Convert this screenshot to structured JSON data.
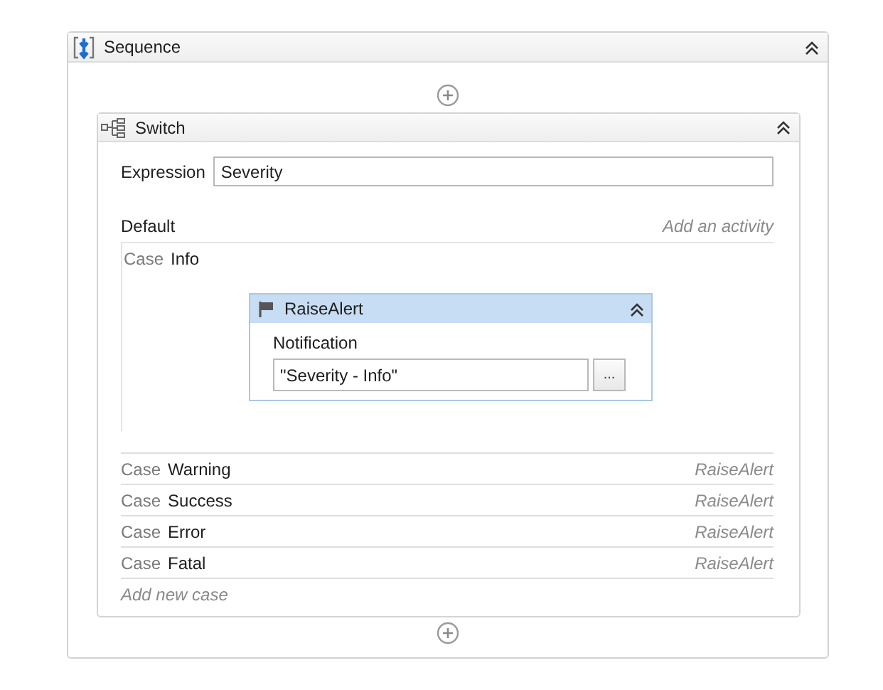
{
  "sequence": {
    "title": "Sequence",
    "expanded": true,
    "switch": {
      "title": "Switch",
      "expanded": true,
      "expression": {
        "label": "Expression",
        "value": "Severity"
      },
      "default": {
        "label": "Default",
        "hint": "Add an activity"
      },
      "open_case": {
        "prefix": "Case",
        "value": "Info",
        "activity": {
          "title": "RaiseAlert",
          "selected": true,
          "expanded": true,
          "field_label": "Notification",
          "field_value": "\"Severity - Info\"",
          "button": "..."
        }
      },
      "cases": [
        {
          "prefix": "Case",
          "value": "Warning",
          "activity": "RaiseAlert"
        },
        {
          "prefix": "Case",
          "value": "Success",
          "activity": "RaiseAlert"
        },
        {
          "prefix": "Case",
          "value": "Error",
          "activity": "RaiseAlert"
        },
        {
          "prefix": "Case",
          "value": "Fatal",
          "activity": "RaiseAlert"
        }
      ],
      "add_case": "Add new case"
    }
  }
}
